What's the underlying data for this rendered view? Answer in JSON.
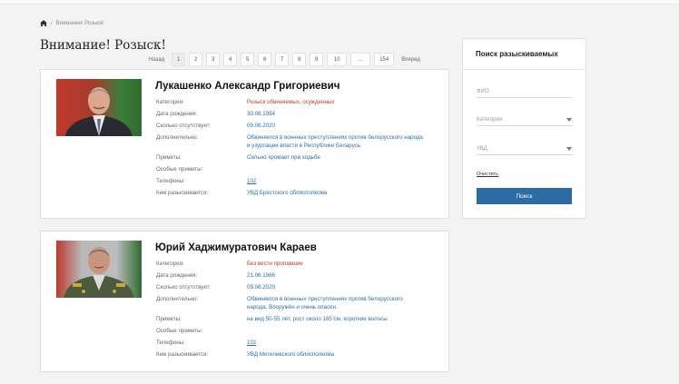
{
  "breadcrumb": {
    "current": "Внимание! Розыск!"
  },
  "page_title": "Внимание! Розыск!",
  "pagination": {
    "prev": "Назад",
    "pages": [
      "1",
      "2",
      "3",
      "4",
      "5",
      "6",
      "7",
      "8",
      "9",
      "10",
      "...",
      "154"
    ],
    "active": "1",
    "next": "Вперед"
  },
  "persons": [
    {
      "name": "Лукашенко Александр Григориевич",
      "fields": [
        {
          "label": "Категория:",
          "value": "Розыск обвиняемых, осужденных",
          "style": "red"
        },
        {
          "label": "Дата рождения:",
          "value": "30.08.1954"
        },
        {
          "label": "Сколько отсутствует:",
          "value": "09.08.2020"
        },
        {
          "label": "Дополнительно:",
          "value": "Обвиняется в военных преступлениях против белорусского народа и узурпации власти в Республике Беларусь"
        },
        {
          "label": "Приметы:",
          "value": "Сильно хромает при ходьбе"
        },
        {
          "label": "Особые приметы:",
          "value": ""
        },
        {
          "label": "Телефоны:",
          "value": "102",
          "style": "link"
        },
        {
          "label": "Кем разыскивается:",
          "value": "УВД Брестского облисполкома"
        }
      ]
    },
    {
      "name": "Юрий Хаджимуратович Караев",
      "fields": [
        {
          "label": "Категория:",
          "value": "Без вести пропавшие",
          "style": "red"
        },
        {
          "label": "Дата рождения:",
          "value": "21.06.1966"
        },
        {
          "label": "Сколько отсутствует:",
          "value": "09.08.2020"
        },
        {
          "label": "Дополнительно:",
          "value": "Обвиняется в военных преступлениях против белорусского народа. Вооружён и очень опасен."
        },
        {
          "label": "Приметы:",
          "value": "на вид 50-55 лет, рост около 185 см, короткие волосы"
        },
        {
          "label": "Особые приметы:",
          "value": ""
        },
        {
          "label": "Телефоны:",
          "value": "102",
          "style": "link"
        },
        {
          "label": "Кем разыскивается:",
          "value": "УВД Могилевского облисполкома"
        }
      ]
    }
  ],
  "sidebar": {
    "title": "Поиск разыскиваемых",
    "fio_placeholder": "ФИО",
    "category_placeholder": "Категория",
    "uvd_placeholder": "УВД",
    "clear_label": "Очистить",
    "search_label": "Поиск"
  },
  "colors": {
    "accent": "#2c6ca6",
    "link": "#2e6fa3",
    "category": "#c0392b"
  }
}
